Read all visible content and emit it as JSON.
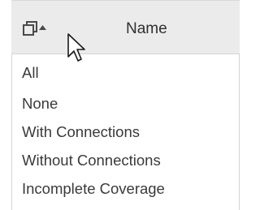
{
  "header": {
    "column_label": "Name",
    "select_icon": "copy-icon",
    "sort_icon": "caret-up-icon"
  },
  "menu": {
    "items": [
      {
        "label": "All"
      },
      {
        "label": "None"
      },
      {
        "label": "With Connections"
      },
      {
        "label": "Without Connections"
      },
      {
        "label": "Incomplete Coverage"
      }
    ]
  },
  "cursor": {
    "icon": "mouse-pointer-icon"
  },
  "colors": {
    "header_bg": "#ebebeb",
    "border": "#d4d4d4",
    "text": "#3a3a3a"
  }
}
